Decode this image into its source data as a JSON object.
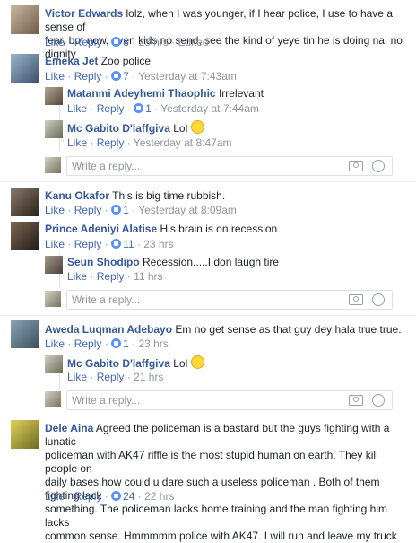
{
  "actions": {
    "like": "Like",
    "reply": "Reply",
    "dot": "·"
  },
  "reply_placeholder": "Write a reply...",
  "c1": {
    "name": "Victor Edwards",
    "text1": "lolz, when I was younger, if I hear police, I use to have a sense of",
    "text2": "fear, but now, even kids no send, see the kind of yeye tin he is doing na, no dignity",
    "likes": "8",
    "time": "23 hrs",
    "edited": "Edited"
  },
  "c2": {
    "name": "Emeka Jet",
    "text": "Zoo police",
    "likes": "7",
    "time": "Yesterday at 7:43am"
  },
  "r2a": {
    "name": "Matanmi Adeyhemi Thaophic",
    "text": "Irrelevant",
    "likes": "1",
    "time": "Yesterday at 7:44am"
  },
  "r2b": {
    "name": "Mc Gabito D'laffgiva",
    "text": "Lol",
    "time": "Yesterday at 8:47am"
  },
  "c3": {
    "name": "Kanu Okafor",
    "text": "This is big time rubbish.",
    "likes": "1",
    "time": "Yesterday at 8:09am"
  },
  "c4": {
    "name": "Prince Adeniyi Alatise",
    "text": "His brain is on recession",
    "likes": "11",
    "time": "23 hrs"
  },
  "r4a": {
    "name": "Seun Shodipo",
    "text": "Recession.....I don laugh tire",
    "time": "11 hrs"
  },
  "c5": {
    "name": "Aweda Luqman Adebayo",
    "text": "Em no get sense as that guy dey hala true true.",
    "likes": "1",
    "time": "23 hrs"
  },
  "r5a": {
    "name": "Mc Gabito D'laffgiva",
    "text": "Lol",
    "time": "21 hrs"
  },
  "c6": {
    "name": "Dele Aina",
    "text1": "Agreed the policeman is a bastard but the guys fighting with a lunatic",
    "text2": "policeman with AK47 riffle is the most stupid human on earth. They kill people on",
    "text3": "daily bases,how could u dare such a useless policeman . Both of them fighting lack",
    "text4": "something. The policeman lacks home training and the man fighting him lacks",
    "text5": "common sense. Hmmmmm police with AK47. I will run and leave my truck",
    "likes": "24",
    "time": "22 hrs"
  }
}
